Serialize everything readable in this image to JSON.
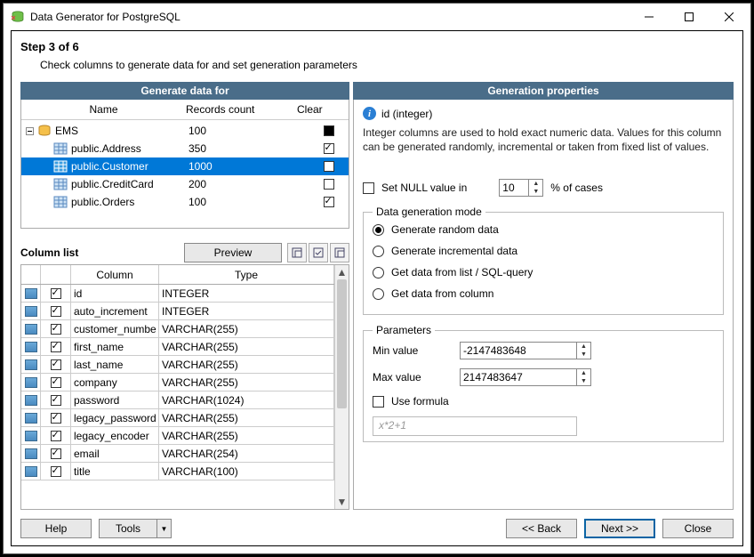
{
  "titlebar": {
    "title": "Data Generator for PostgreSQL"
  },
  "step": {
    "title": "Step 3 of 6",
    "subtitle": "Check columns to generate data for and set generation parameters"
  },
  "left": {
    "panel_title": "Generate data for",
    "headers": {
      "name": "Name",
      "records": "Records count",
      "clear": "Clear"
    },
    "tree": [
      {
        "level": 0,
        "name": "EMS",
        "records": "100",
        "clear": "filled"
      },
      {
        "level": 1,
        "name": "public.Address",
        "records": "350",
        "clear": "checked"
      },
      {
        "level": 1,
        "name": "public.Customer",
        "records": "1000",
        "clear": "unchecked",
        "selected": true
      },
      {
        "level": 1,
        "name": "public.CreditCard",
        "records": "200",
        "clear": "unchecked"
      },
      {
        "level": 1,
        "name": "public.Orders",
        "records": "100",
        "clear": "checked"
      }
    ],
    "col_list_label": "Column list",
    "preview_btn": "Preview",
    "col_headers": {
      "column": "Column",
      "type": "Type"
    },
    "columns": [
      {
        "checked": true,
        "name": "id",
        "type": "INTEGER"
      },
      {
        "checked": true,
        "name": "auto_increment",
        "type": "INTEGER"
      },
      {
        "checked": true,
        "name": "customer_numbe",
        "type": "VARCHAR(255)"
      },
      {
        "checked": true,
        "name": "first_name",
        "type": "VARCHAR(255)"
      },
      {
        "checked": true,
        "name": "last_name",
        "type": "VARCHAR(255)"
      },
      {
        "checked": true,
        "name": "company",
        "type": "VARCHAR(255)"
      },
      {
        "checked": true,
        "name": "password",
        "type": "VARCHAR(1024)"
      },
      {
        "checked": true,
        "name": "legacy_password",
        "type": "VARCHAR(255)"
      },
      {
        "checked": true,
        "name": "legacy_encoder",
        "type": "VARCHAR(255)"
      },
      {
        "checked": true,
        "name": "email",
        "type": "VARCHAR(254)"
      },
      {
        "checked": true,
        "name": "title",
        "type": "VARCHAR(100)"
      }
    ]
  },
  "right": {
    "panel_title": "Generation properties",
    "info_title": "id (integer)",
    "description": "Integer columns are used to hold exact numeric data. Values for this column can be generated randomly, incremental or taken from fixed list of values.",
    "null_label": "Set NULL value in",
    "null_value": "10",
    "null_suffix": "% of cases",
    "mode_legend": "Data generation mode",
    "modes": {
      "random": "Generate random data",
      "incremental": "Generate incremental data",
      "list": "Get data from list / SQL-query",
      "column": "Get data from column"
    },
    "mode_selected": "random",
    "params_legend": "Parameters",
    "min_label": "Min value",
    "min_value": "-2147483648",
    "max_label": "Max value",
    "max_value": "2147483647",
    "formula_label": "Use formula",
    "formula_placeholder": "x*2+1"
  },
  "footer": {
    "help": "Help",
    "tools": "Tools",
    "back": "<< Back",
    "next": "Next >>",
    "close": "Close"
  }
}
